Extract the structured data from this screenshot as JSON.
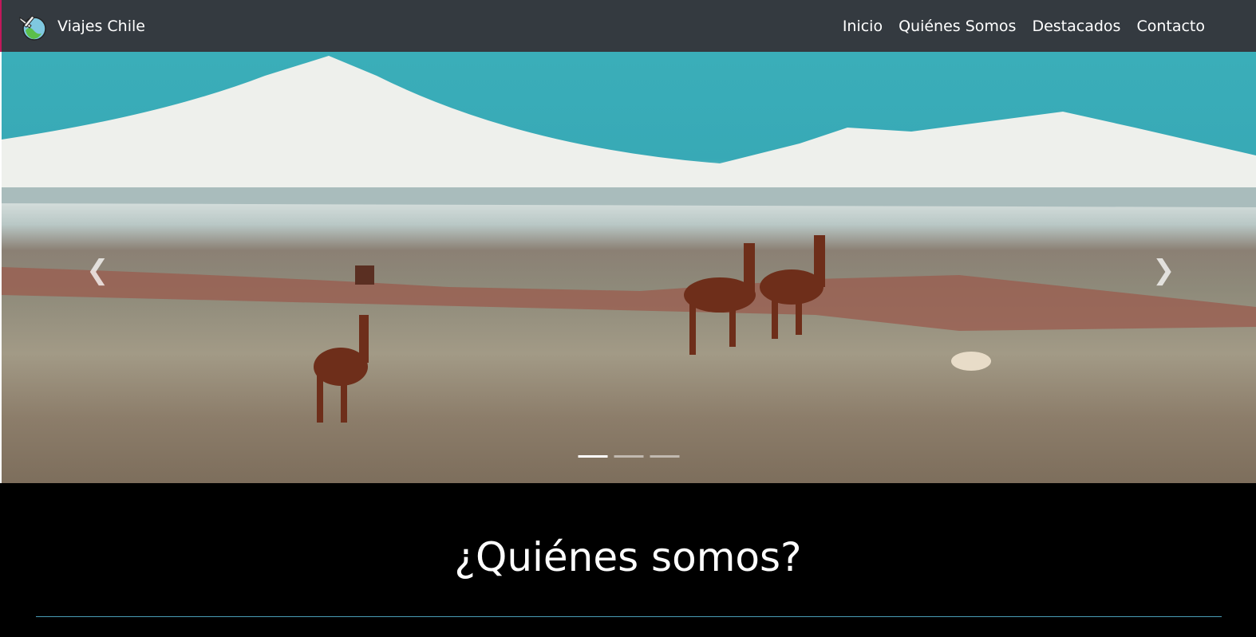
{
  "navbar": {
    "brand": "Viajes Chile",
    "items": [
      "Inicio",
      "Quiénes Somos",
      "Destacados",
      "Contacto"
    ]
  },
  "carousel": {
    "slides": 3,
    "active_slide": 1,
    "prev_icon": "chevron-left-icon",
    "next_icon": "chevron-right-icon"
  },
  "about": {
    "title": "¿Quiénes somos?"
  },
  "colors": {
    "navbar": "#343a40",
    "divider": "#4a9cb5"
  }
}
